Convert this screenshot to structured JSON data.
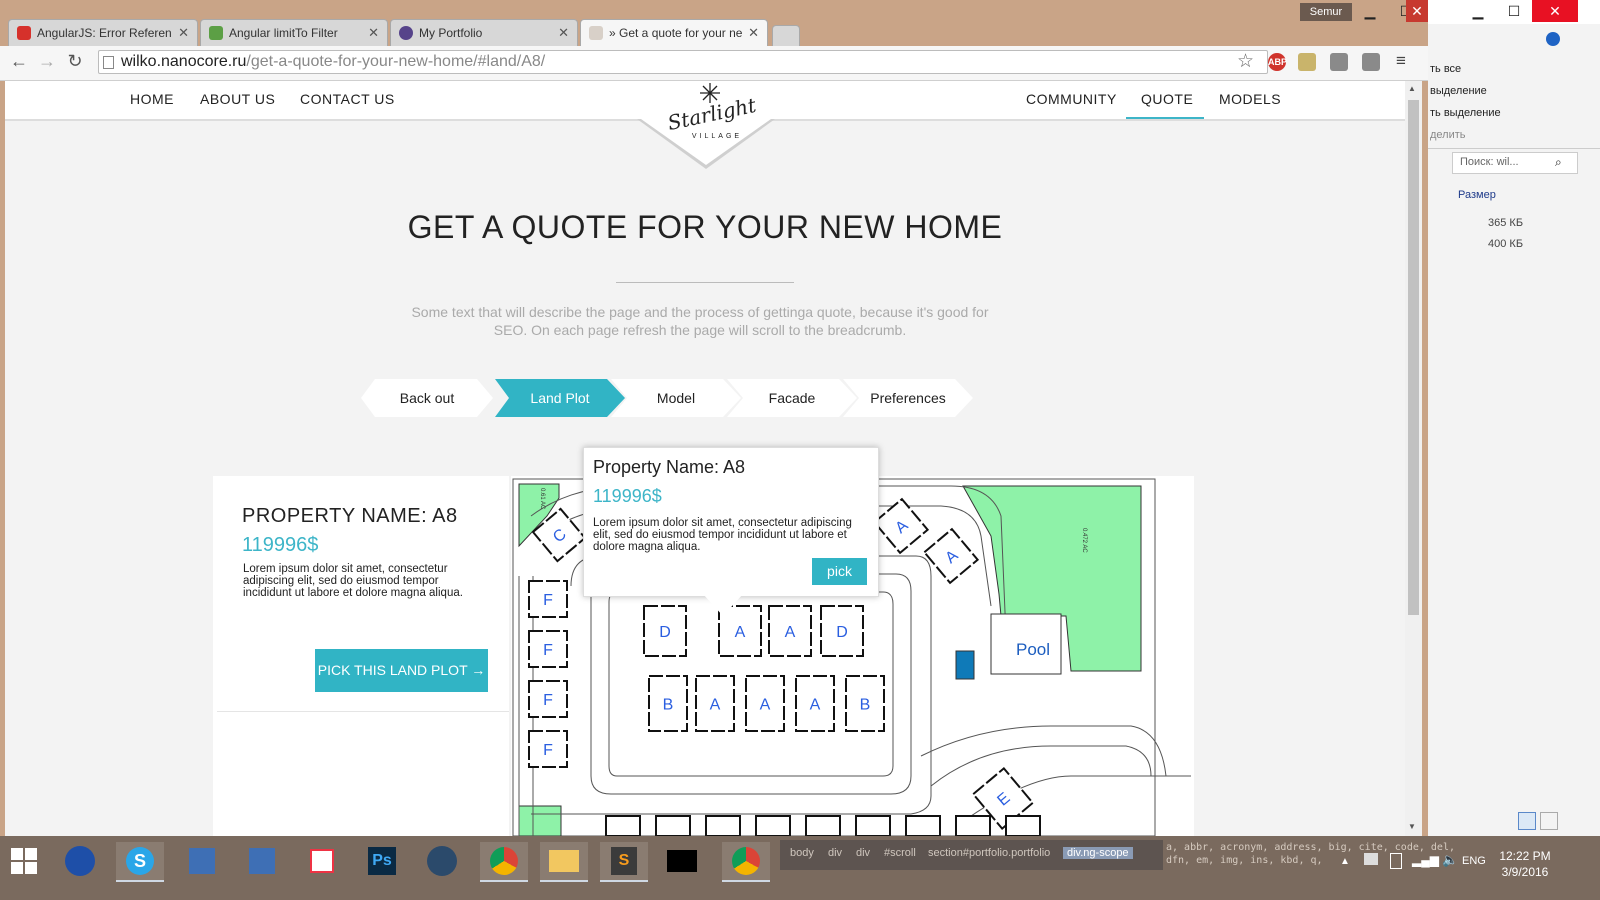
{
  "browser": {
    "tabs": [
      {
        "title": "AngularJS: Error Reference",
        "icon": "angular-icon",
        "color": "#d6312b"
      },
      {
        "title": "Angular limitTo Filter",
        "icon": "w3schools-icon",
        "color": "#5c9f45"
      },
      {
        "title": "My Portfolio",
        "icon": "portfolio-icon",
        "color": "#56438a"
      },
      {
        "title": "» Get a quote for your new",
        "icon": "starlight-icon",
        "color": "#777777"
      }
    ],
    "user": "Semur",
    "url_host": "wilko.nanocore.ru",
    "url_path": "/get-a-quote-for-your-new-home/#land/A8/",
    "extensions": {
      "abp": "ABP"
    }
  },
  "site": {
    "nav_left": [
      "HOME",
      "ABOUT US",
      "CONTACT US"
    ],
    "nav_right": [
      "COMMUNITY",
      "QUOTE",
      "MODELS"
    ],
    "logo_text": "Starlight",
    "logo_sub": "VILLAGE",
    "title": "GET A QUOTE FOR YOUR NEW HOME",
    "intro": "Some text that will describe the page and the process of gettinga quote, because it's good for SEO. On each page refresh the page will scroll to the breadcrumb.",
    "steps": [
      "Back out",
      "Land Plot",
      "Model",
      "Facade",
      "Preferences"
    ],
    "accent": "#31b4c5"
  },
  "card": {
    "title": "PROPERTY NAME: A8",
    "price": "119996$",
    "description": "Lorem ipsum dolor sit amet, consectetur adipiscing elit, sed do eiusmod tempor incididunt ut labore et dolore magna aliqua.",
    "button": "PICK THIS LAND PLOT →"
  },
  "popup": {
    "title": "Property Name: A8",
    "price": "119996$",
    "description": "Lorem ipsum dolor sit amet, consectetur adipiscing elit, sed do eiusmod tempor incididunt ut labore et dolore magna aliqua.",
    "button": "pick"
  },
  "map": {
    "pool_label": "Pool",
    "area_left": "0.61 AC",
    "area_right": "0.472 AC",
    "inner_lots_top": [
      "D",
      "A",
      "A",
      "D"
    ],
    "inner_lots_bottom": [
      "B",
      "A",
      "A",
      "A",
      "B"
    ],
    "left_lots": [
      "F",
      "F",
      "F",
      "F"
    ],
    "outer_lots": [
      "C",
      "A",
      "A",
      "E"
    ]
  },
  "explorer": {
    "menu": [
      "ть все",
      "выделение",
      "ть выделение",
      "делить"
    ],
    "search_placeholder": "Поиск: wil...",
    "column": "Размер",
    "sizes": [
      "365 КБ",
      "400 КБ"
    ]
  },
  "taskbar": {
    "crumbs": [
      "body",
      "div",
      "div",
      "#scroll",
      "section#portfolio.portfolio",
      "div.ng-scope"
    ],
    "css_hint": "a, abbr, acronym, address, big, cite, code, del,",
    "css_hint2": "dfn, em, img, ins, kbd, q,",
    "lang": "ENG",
    "time": "12:22 PM",
    "date": "3/9/2016"
  }
}
